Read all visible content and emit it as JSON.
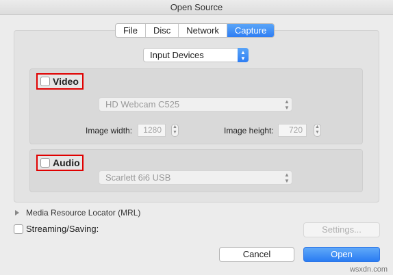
{
  "window": {
    "title": "Open Source"
  },
  "tabs": [
    {
      "label": "File",
      "active": false
    },
    {
      "label": "Disc",
      "active": false
    },
    {
      "label": "Network",
      "active": false
    },
    {
      "label": "Capture",
      "active": true
    }
  ],
  "capture_type": {
    "selected": "Input Devices"
  },
  "video": {
    "label": "Video",
    "checked": false,
    "device": "HD Webcam C525",
    "image_width_label": "Image width:",
    "image_width": "1280",
    "image_height_label": "Image height:",
    "image_height": "720"
  },
  "audio": {
    "label": "Audio",
    "checked": false,
    "device": "Scarlett 6i6 USB"
  },
  "mrl": {
    "label": "Media Resource Locator (MRL)"
  },
  "streaming": {
    "label": "Streaming/Saving:",
    "checked": false,
    "settings_label": "Settings..."
  },
  "buttons": {
    "cancel": "Cancel",
    "open": "Open"
  },
  "watermark": "wsxdn.com",
  "colors": {
    "accent": "#2f7ef3",
    "highlight_box": "#e00000"
  }
}
